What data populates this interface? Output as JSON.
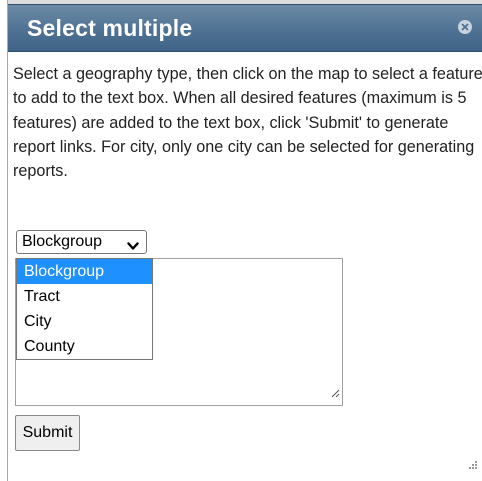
{
  "dialog": {
    "title": "Select multiple",
    "close_icon": "close-icon",
    "instructions": "Select a geography type, then click on the map to select a feature to add to the text box. When all desired features (maximum is 5 features) are added to the text box, click 'Submit' to generate report links. For city, only one city can be selected for generating reports."
  },
  "geography_select": {
    "selected_value": "Blockgroup",
    "chevron_icon": "chevron-down-icon",
    "options": [
      {
        "label": "Blockgroup",
        "selected": true
      },
      {
        "label": "Tract",
        "selected": false
      },
      {
        "label": "City",
        "selected": false
      },
      {
        "label": "County",
        "selected": false
      }
    ]
  },
  "features_textbox": {
    "value": ""
  },
  "submit": {
    "label": "Submit"
  },
  "colors": {
    "titlebar": "#4f7294",
    "selected_option": "#1e90ff"
  }
}
